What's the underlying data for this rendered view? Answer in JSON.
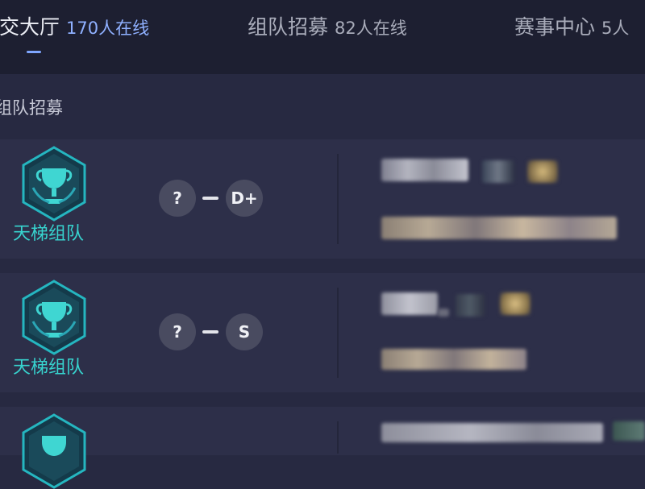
{
  "header": {
    "tabs": [
      {
        "name": "社交大厅",
        "count": "170人在线",
        "active": true
      },
      {
        "name": "组队招募",
        "count": "82人在线",
        "active": false
      },
      {
        "name": "赛事中心",
        "count": "5人",
        "active": false
      }
    ]
  },
  "section": {
    "title": "组队招募"
  },
  "recruit_cards": [
    {
      "badge_label": "天梯组队",
      "rank_low": "?",
      "rank_high": "D+"
    },
    {
      "badge_label": "天梯组队",
      "rank_low": "?",
      "rank_high": "S"
    },
    {
      "badge_label": "",
      "rank_low": "",
      "rank_high": ""
    }
  ],
  "colors": {
    "accent": "#8fb0ff",
    "badge_teal": "#37d4cf",
    "background": "#272941",
    "card": "#2d2f49",
    "topbar": "#1d1f31"
  },
  "icons": {
    "badge": "trophy-shield-icon"
  }
}
